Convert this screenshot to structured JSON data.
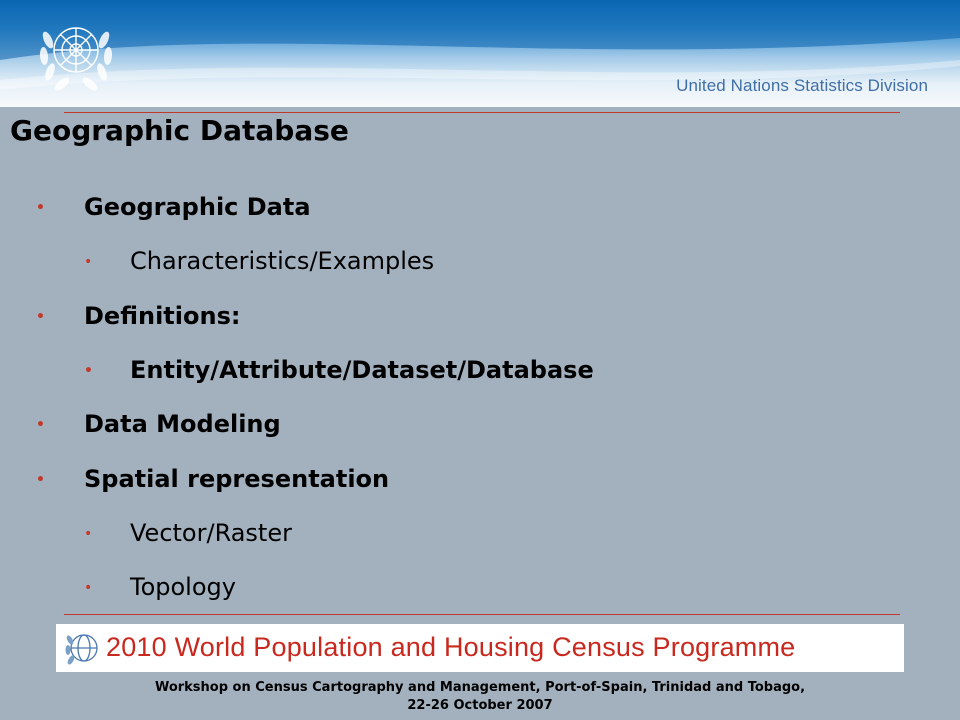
{
  "header": {
    "division": "United Nations Statistics Division",
    "logo_icon": "un-emblem-icon"
  },
  "slide": {
    "title": "Geographic Database",
    "bullets": [
      {
        "text": "Geographic Data",
        "level": 1,
        "bold": true
      },
      {
        "text": "Characteristics/Examples",
        "level": 2,
        "bold": false
      },
      {
        "text": "Definitions:",
        "level": 1,
        "bold": true
      },
      {
        "text": "Entity/Attribute/Dataset/Database",
        "level": 2,
        "bold": true
      },
      {
        "text": "Data Modeling",
        "level": 1,
        "bold": true
      },
      {
        "text": "Spatial representation",
        "level": 1,
        "bold": true
      },
      {
        "text": "Vector/Raster",
        "level": 2,
        "bold": false
      },
      {
        "text": "Topology",
        "level": 2,
        "bold": false
      }
    ],
    "bullet_glyph": "•"
  },
  "banner": {
    "text": "2010 World Population and Housing Census Programme",
    "logo_icon": "census-programme-logo-icon"
  },
  "footer": {
    "line1": "Workshop on Census Cartography and Management, Port-of-Spain, Trinidad and Tobago,",
    "line2": "22-26 October 2007"
  },
  "colors": {
    "background": "#a3b1be",
    "accent": "#c0392b",
    "header_blue": "#0d6bb8",
    "division_text": "#3f6fa6",
    "banner_text": "#c8281e"
  }
}
